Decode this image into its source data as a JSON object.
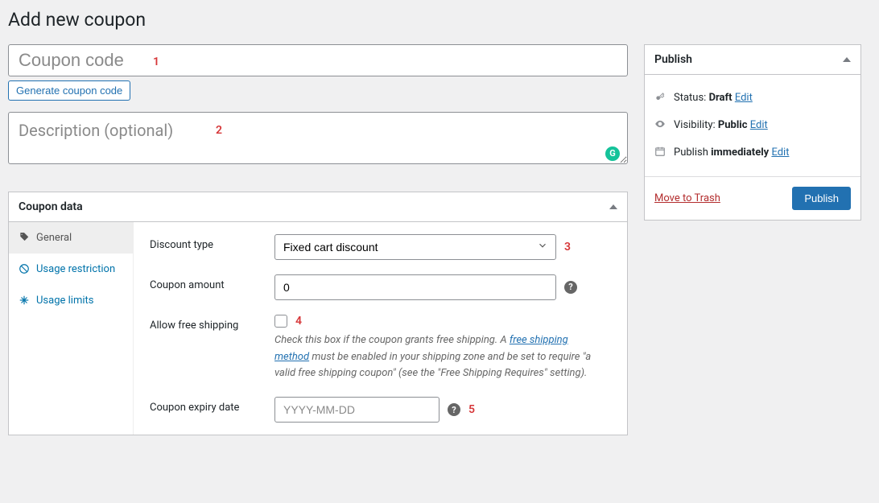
{
  "page_title": "Add new coupon",
  "coupon_code": {
    "placeholder": "Coupon code"
  },
  "generate_btn": "Generate coupon code",
  "description": {
    "placeholder": "Description (optional)"
  },
  "coupon_data": {
    "title": "Coupon data",
    "tabs": {
      "general": "General",
      "usage_restriction": "Usage restriction",
      "usage_limits": "Usage limits"
    },
    "general": {
      "discount_type_label": "Discount type",
      "discount_type_value": "Fixed cart discount",
      "coupon_amount_label": "Coupon amount",
      "coupon_amount_value": "0",
      "allow_free_shipping_label": "Allow free shipping",
      "free_shipping_hint_before": "Check this box if the coupon grants free shipping. A ",
      "free_shipping_link": "free shipping method",
      "free_shipping_hint_after": " must be enabled in your shipping zone and be set to require \"a valid free shipping coupon\" (see the \"Free Shipping Requires\" setting).",
      "expiry_label": "Coupon expiry date",
      "expiry_placeholder": "YYYY-MM-DD"
    }
  },
  "publish": {
    "title": "Publish",
    "status_label": "Status:",
    "status_value": "Draft",
    "edit": "Edit",
    "visibility_label": "Visibility:",
    "visibility_value": "Public",
    "publish_label": "Publish",
    "publish_value": "immediately",
    "trash": "Move to Trash",
    "publish_btn": "Publish"
  },
  "annotations": {
    "a1": "1",
    "a2": "2",
    "a3": "3",
    "a4": "4",
    "a5": "5"
  }
}
